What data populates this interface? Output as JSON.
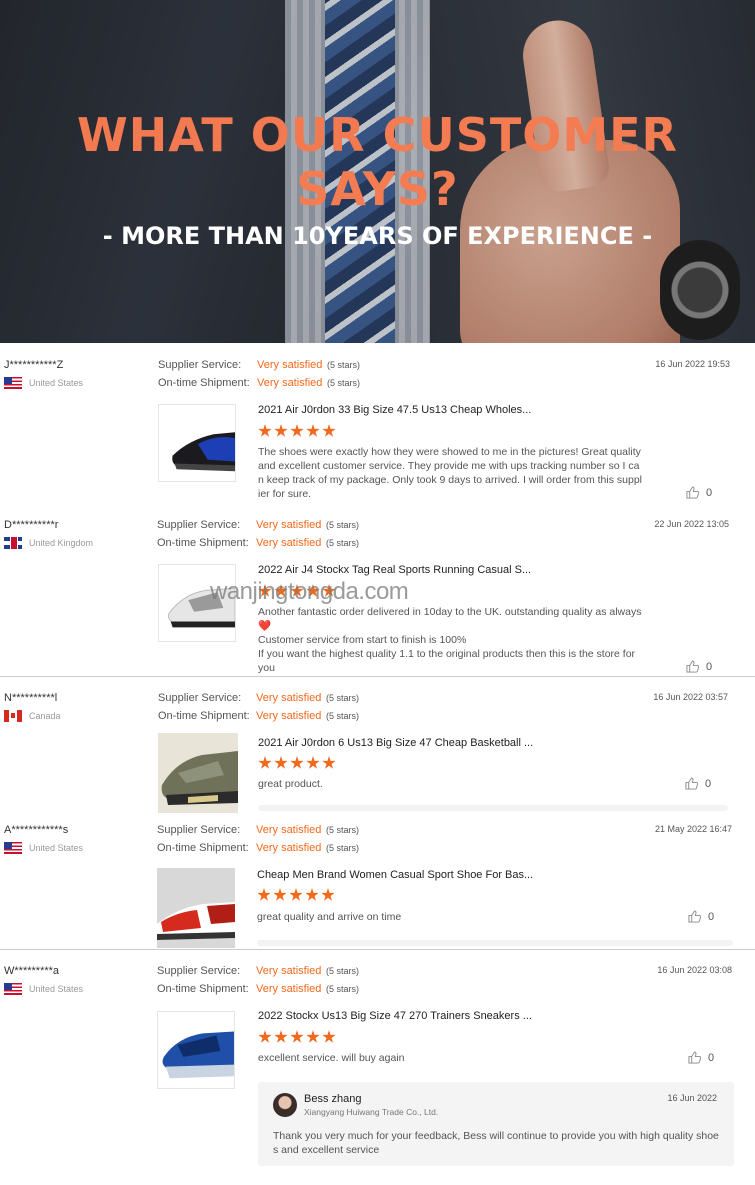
{
  "hero": {
    "title_part1": "WHAT OUR ",
    "title_part2": "CUSTOMER SAYS?",
    "subtitle": "- MORE THAN 10YEARS OF EXPERIENCE -"
  },
  "labels": {
    "supplier_service": "Supplier Service:",
    "ontime_shipment": "On-time Shipment:"
  },
  "watermark": "wanjingtongda.com",
  "reviews": [
    {
      "name": "J***********Z",
      "country": "United States",
      "flag": "us",
      "supplier_rating": "Very satisfied",
      "supplier_stars": "(5 stars)",
      "shipment_rating": "Very satisfied",
      "shipment_stars": "(5 stars)",
      "date": "16 Jun 2022 19:53",
      "product_title": "2021 Air J0rdon 33 Big Size 47.5 Us13 Cheap Wholes...",
      "comment": "The shoes were exactly how they were showed to me in the pictures! Great quality and excellent customer service. They provide me with ups tracking number so I can keep track of my package. Only took 9 days to arrived. I will order from this supplier for sure.",
      "likes": "0"
    },
    {
      "name": "D**********r",
      "country": "United Kingdom",
      "flag": "uk",
      "supplier_rating": "Very satisfied",
      "supplier_stars": "(5 stars)",
      "shipment_rating": "Very satisfied",
      "shipment_stars": "(5 stars)",
      "date": "22 Jun 2022 13:05",
      "product_title": "2022 Air J4 Stockx Tag Real Sports Running Casual S...",
      "comment_lines": [
        "Another fantastic order delivered in 10day to the UK. outstanding quality as always ❤️",
        "Customer service from start to finish is 100%",
        "If you want the highest quality 1.1 to the original products then this is the store for you"
      ],
      "likes": "0"
    },
    {
      "name": "N**********l",
      "country": "Canada",
      "flag": "ca",
      "supplier_rating": "Very satisfied",
      "supplier_stars": "(5 stars)",
      "shipment_rating": "Very satisfied",
      "shipment_stars": "(5 stars)",
      "date": "16 Jun 2022 03:57",
      "product_title": "2021 Air J0rdon 6 Us13 Big Size 47 Cheap Basketball ...",
      "comment": "great product.",
      "likes": "0"
    },
    {
      "name": "A************s",
      "country": "United States",
      "flag": "us",
      "supplier_rating": "Very satisfied",
      "supplier_stars": "(5 stars)",
      "shipment_rating": "Very satisfied",
      "shipment_stars": "(5 stars)",
      "date": "21 May 2022 16:47",
      "product_title": "Cheap Men Brand Women Casual Sport Shoe For Bas...",
      "comment": "great quality and arrive on time",
      "likes": "0"
    },
    {
      "name": "W*********a",
      "country": "United States",
      "flag": "us",
      "supplier_rating": "Very satisfied",
      "supplier_stars": "(5 stars)",
      "shipment_rating": "Very satisfied",
      "shipment_stars": "(5 stars)",
      "date": "16 Jun 2022 03:08",
      "product_title": "2022 Stockx Us13 Big Size 47 270 Trainers Sneakers ...",
      "comment": "excellent service. will buy again",
      "likes": "0",
      "reply": {
        "name": "Bess zhang",
        "company": "Xiangyang Huiwang Trade Co., Ltd.",
        "date": "16 Jun 2022",
        "text": "Thank you very much for your feedback, Bess will continue to provide you with high quality shoes and excellent service"
      }
    }
  ],
  "colors": {
    "accent": "#f2691c",
    "hero_title": "#f37a50"
  }
}
